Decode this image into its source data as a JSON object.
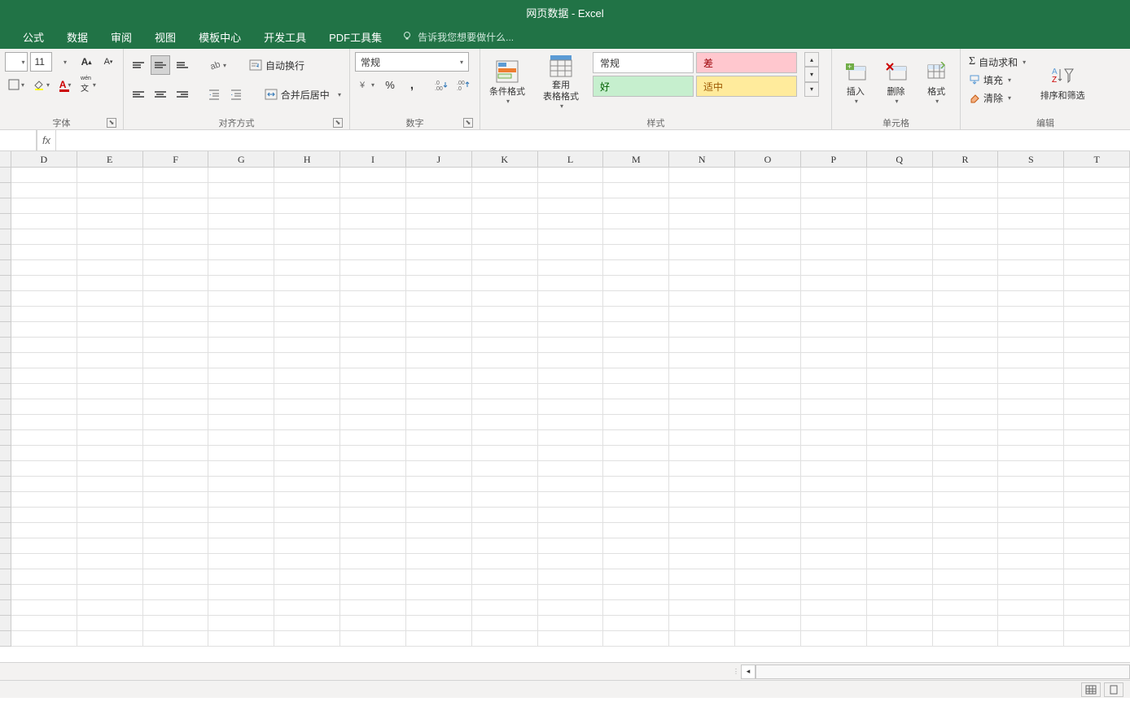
{
  "title": "网页数据 - Excel",
  "menu": {
    "tabs": [
      "公式",
      "数据",
      "审阅",
      "视图",
      "模板中心",
      "开发工具",
      "PDF工具集"
    ],
    "tellme": "告诉我您想要做什么..."
  },
  "ribbon": {
    "font": {
      "size": "11",
      "group_label": "字体"
    },
    "alignment": {
      "wrap": "自动换行",
      "merge": "合并后居中",
      "group_label": "对齐方式"
    },
    "number": {
      "format": "常规",
      "group_label": "数字"
    },
    "styles": {
      "conditional": "条件格式",
      "table_format": "套用\n表格格式",
      "normal": "常规",
      "bad": "差",
      "good": "好",
      "neutral": "适中",
      "group_label": "样式"
    },
    "cells": {
      "insert": "插入",
      "delete": "删除",
      "format": "格式",
      "group_label": "单元格"
    },
    "editing": {
      "autosum": "自动求和",
      "fill": "填充",
      "clear": "清除",
      "sort_filter": "排序和筛选",
      "group_label": "编辑"
    }
  },
  "formula_bar": {
    "fx": "fx",
    "value": ""
  },
  "grid": {
    "columns": [
      "D",
      "E",
      "F",
      "G",
      "H",
      "I",
      "J",
      "K",
      "L",
      "M",
      "N",
      "O",
      "P",
      "Q",
      "R",
      "S",
      "T"
    ],
    "row_count": 31
  }
}
